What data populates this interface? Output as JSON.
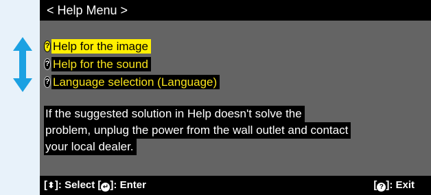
{
  "title": "< Help Menu >",
  "menu_items": [
    {
      "label": "Help for the image",
      "selected": true
    },
    {
      "label": "Help for the sound",
      "selected": false
    },
    {
      "label": "Language selection (Language)",
      "selected": false
    }
  ],
  "message_lines": [
    "If the suggested solution in Help doesn't solve the",
    "problem, unplug the power from the wall outlet and contact",
    "your local dealer."
  ],
  "footer": {
    "select_text": "]: Select [",
    "enter_text": "]: Enter",
    "exit_text": "]: Exit",
    "bracket_open": "["
  },
  "icons": {
    "help_item": "help-icon",
    "nav": "up-down-arrow-icon",
    "select_key": "up-down-key-icon",
    "enter_key": "enter-key-icon",
    "exit_key": "help-key-icon"
  },
  "colors": {
    "menu_text": "#f7e21b",
    "highlight": "#ffef00",
    "screen_bg": "#646464",
    "arrow": "#1ba1e2"
  }
}
